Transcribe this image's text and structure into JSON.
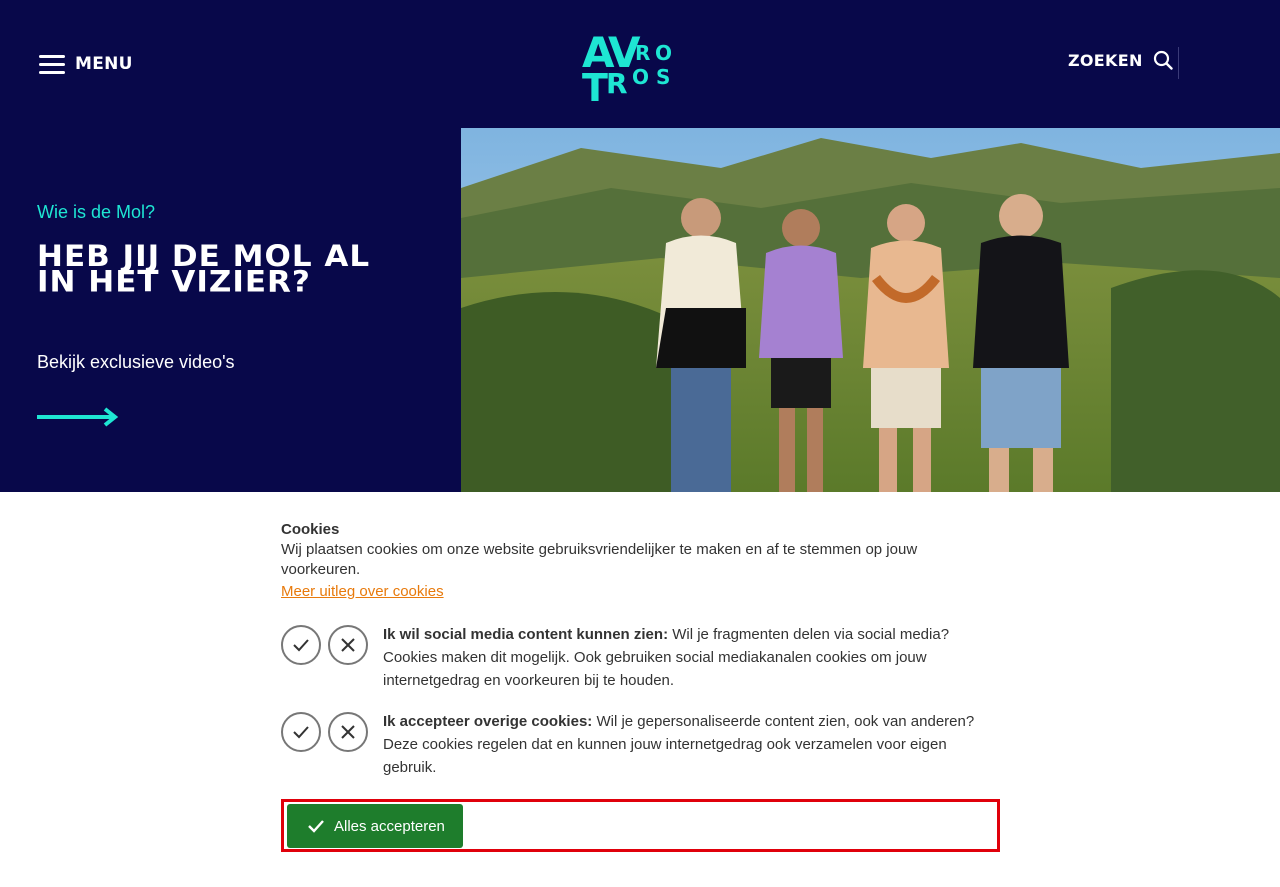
{
  "header": {
    "menu_label": "MENU",
    "search_label": "ZOEKEN",
    "logo_text": "AVRO TROS"
  },
  "hero": {
    "subtitle": "Wie is de Mol?",
    "title": "HEB JIJ DE MOL AL IN HET VIZIER?",
    "description": "Bekijk exclusieve video's",
    "arrow_icon": "arrow-right-icon"
  },
  "cookies": {
    "title": "Cookies",
    "intro": "Wij plaatsen cookies om onze website gebruiksvriendelijker te maken en af te stemmen op jouw voorkeuren.",
    "more_link": "Meer uitleg over cookies",
    "preferences": [
      {
        "heading": "Ik wil social media content kunnen zien:",
        "text": "Wil je fragmenten delen via social media? Cookies maken dit mogelijk. Ook gebruiken social mediakanalen cookies om jouw internetgedrag en voorkeuren bij te houden."
      },
      {
        "heading": "Ik accepteer overige cookies:",
        "text": "Wil je gepersonaliseerde content zien, ook van anderen? Deze cookies regelen dat en kunnen jouw internetgedrag ook verzamelen voor eigen gebruik."
      }
    ],
    "accept_all_label": "Alles accepteren"
  },
  "colors": {
    "brand_navy": "#08084a",
    "brand_teal": "#1ee6d3",
    "link_orange": "#e87a0c",
    "accept_green": "#1e7d2c",
    "highlight_red": "#e0000b"
  }
}
